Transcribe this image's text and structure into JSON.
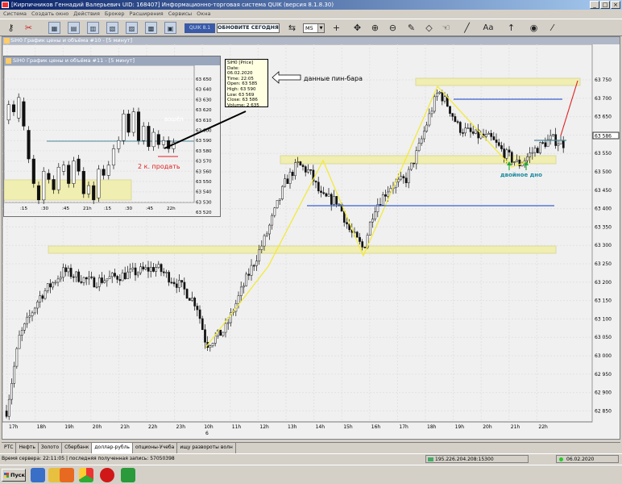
{
  "window": {
    "title": "[Кирпичников Геннадий Валерьевич UID: 168407] Информационно-торговая система QUIK (версия 8.1.8.30)"
  },
  "menu": [
    "Система",
    "Создать окно",
    "Действия",
    "Брокер",
    "Расширения",
    "Сервисы",
    "Окна"
  ],
  "toolbar": {
    "quik_label": "QUIK 8.1",
    "update_label": "ОБНОВИТЕ СЕГОДНЯ",
    "timeframe": "M5",
    "text_tool": "Aa"
  },
  "main_chart": {
    "title": "SiH0 График цены и объёма #10 - [5 минут]",
    "price_labels": [
      "63 750",
      "63 700",
      "63 650",
      "63 600",
      "63 550",
      "63 500",
      "63 450",
      "63 400",
      "63 350",
      "63 300",
      "63 250",
      "63 200",
      "63 150",
      "63 100",
      "63 050",
      "63 000",
      "62 950",
      "62 900",
      "62 850"
    ],
    "last_price": "63 586",
    "time_labels": [
      "17h",
      "18h",
      "19h",
      "20h",
      "21h",
      "22h",
      "23h",
      "10h",
      "11h",
      "12h",
      "13h",
      "14h",
      "15h",
      "16h",
      "17h",
      "18h",
      "19h",
      "20h",
      "21h",
      "22h"
    ],
    "day_marker": "6",
    "annot_pinbar": "данные пин-бара",
    "annot_double": "двойное дно"
  },
  "sub_chart": {
    "title": "SiH0 График цены и объёма #11 - [5 минут]",
    "price_labels": [
      "63 650",
      "63 640",
      "63 630",
      "63 620",
      "63 610",
      "63 600",
      "63 590",
      "63 580",
      "63 570",
      "63 560",
      "63 550",
      "63 540",
      "63 530",
      "63 520"
    ],
    "time_labels": [
      ":15",
      ":30",
      ":45",
      "21h",
      ":15",
      ":30",
      ":45",
      "22h"
    ],
    "annot_entered": "вошёл",
    "annot_sell": "2 к. продать"
  },
  "tooltip": {
    "lines": [
      "SiH0 [Price]",
      "Date: 06.02.2020",
      "Time: 22:05",
      "Open:  63 585",
      "High:   63 590",
      "Low:    63 569",
      "Close:  63 586",
      "Volume: 2 635"
    ]
  },
  "tabs": [
    "РТС",
    "Нефть",
    "Золото",
    "Сбербанк",
    "доллар-рубль",
    "опционы-Учеба",
    "ищу развороты волн"
  ],
  "active_tab": 4,
  "status": {
    "left": "Время сервера: 22:11:05 | последняя полученная запись: 57050398",
    "connection": "195.226.204.208:15300",
    "date": "06.02.2020"
  },
  "taskbar": {
    "start_label": "Пуск"
  },
  "colors": {
    "zone": "#f0eeb0",
    "blue_line": "#3a5fcf",
    "teal_line": "#4a8a9a",
    "yellow_wave": "#f2ea3a",
    "red_line": "#e02020",
    "candle": "#111111",
    "bg": "#f0f0f0"
  },
  "icons": [
    "key-icon",
    "scissors-icon",
    "chart-icon",
    "crosshair-icon",
    "move-icon",
    "zoom-in-icon",
    "zoom-out-icon",
    "pencil-icon",
    "eraser-icon",
    "hand-icon",
    "line-icon",
    "arrow-up-icon",
    "eye-icon",
    "brush-icon"
  ]
}
